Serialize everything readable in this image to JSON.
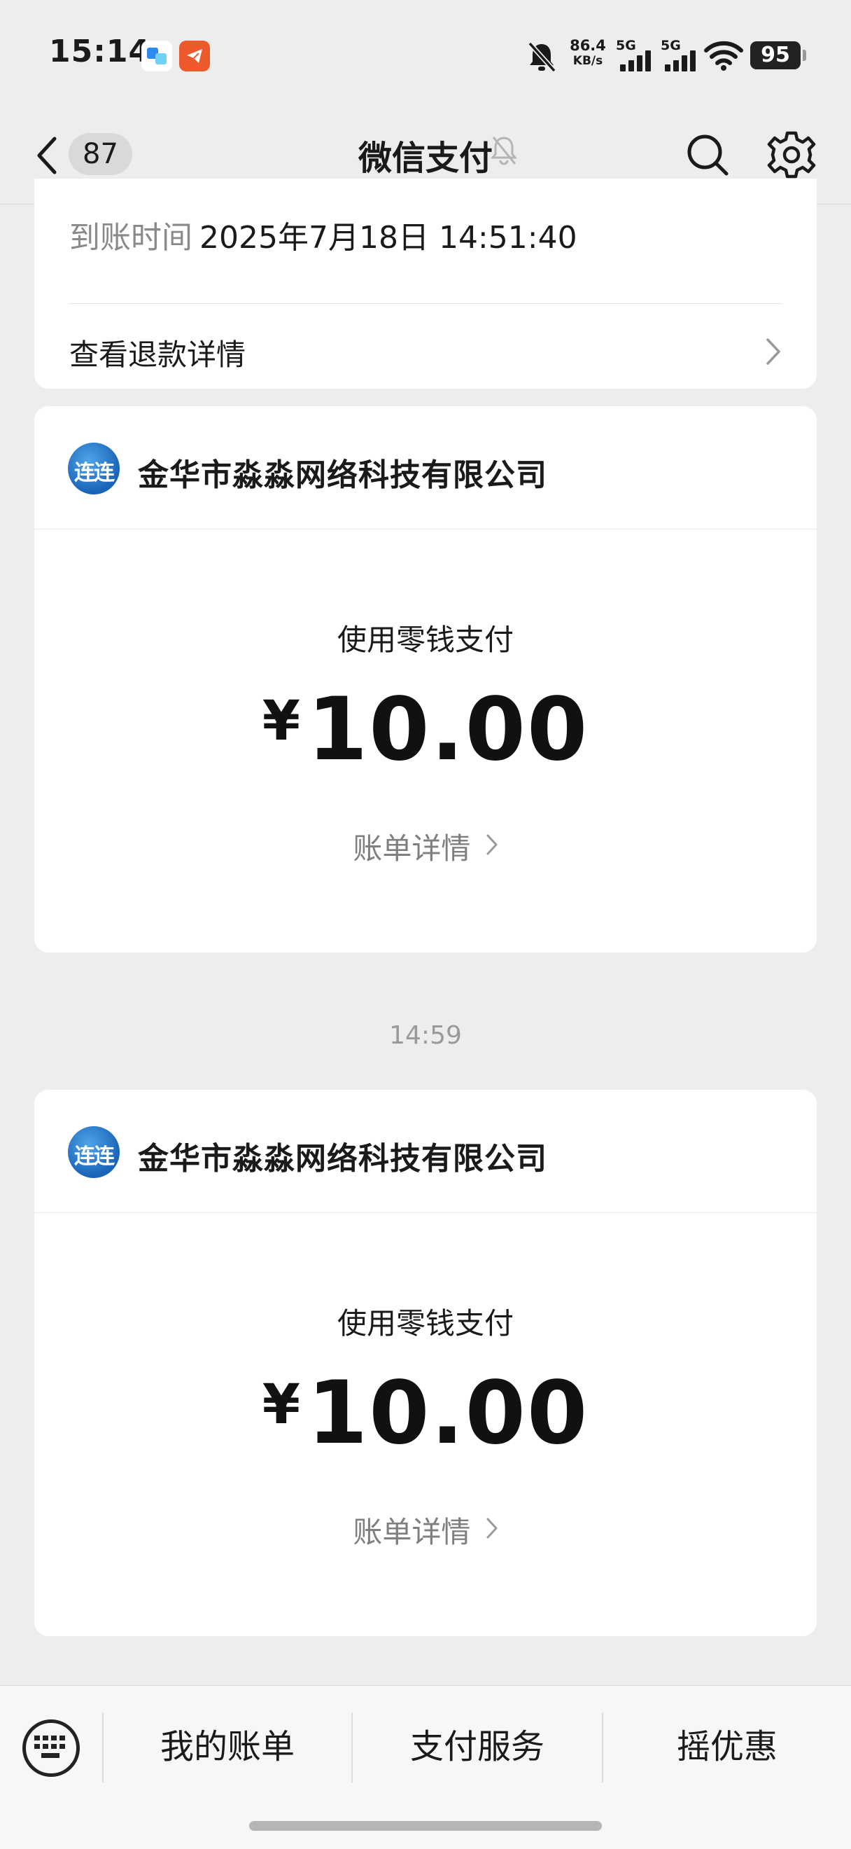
{
  "status_bar": {
    "time": "15:14",
    "net_speed_value": "86.4",
    "net_speed_unit": "KB/s",
    "signal1_label": "5G",
    "signal2_label": "5G",
    "battery": "95",
    "icons": [
      "notification-app-icon",
      "telegram-app-icon",
      "bell-off-icon",
      "signal-icon",
      "wifi-icon",
      "battery-icon"
    ]
  },
  "nav": {
    "title": "微信支付",
    "unread_count": "87",
    "icons": [
      "back-arrow-icon",
      "mute-icon",
      "search-icon",
      "settings-icon"
    ]
  },
  "top_card": {
    "arrival_time_label": "到账时间",
    "arrival_time_value": "2025年7月18日 14:51:40",
    "refund_link": "查看退款详情"
  },
  "payments": [
    {
      "merchant_logo_text": "连连",
      "merchant_name": "金华市淼淼网络科技有限公司",
      "pay_method": "使用零钱支付",
      "currency": "¥",
      "amount": "10.00",
      "bill_link": "账单详情"
    },
    {
      "merchant_logo_text": "连连",
      "merchant_name": "金华市淼淼网络科技有限公司",
      "pay_method": "使用零钱支付",
      "currency": "¥",
      "amount": "10.00",
      "bill_link": "账单详情"
    }
  ],
  "timestamp": "14:59",
  "bottom_menu": {
    "items": [
      "我的账单",
      "支付服务",
      "摇优惠"
    ]
  }
}
